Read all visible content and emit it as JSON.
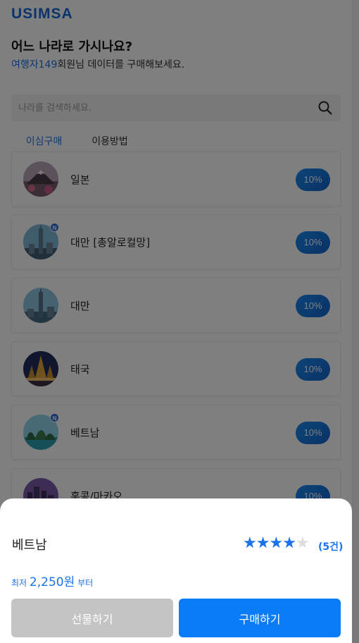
{
  "brand": {
    "logo": "USIMSA"
  },
  "header": {
    "title": "어느 나라로 가시나요?",
    "subtitle_highlight": "여행자149",
    "subtitle_rest": "회원님 데이터를 구매해보세요."
  },
  "search": {
    "placeholder": "나라를 검색하세요.",
    "value": "",
    "icon": "search-icon"
  },
  "tabs": [
    {
      "label": "이심구매",
      "active": true
    },
    {
      "label": "이용방법",
      "active": false
    }
  ],
  "countries": [
    {
      "name": "일본",
      "discount": "10%",
      "is_new": false,
      "badge": ""
    },
    {
      "name": "대만 [총알로컬망]",
      "discount": "10%",
      "is_new": true,
      "badge": "N"
    },
    {
      "name": "대만",
      "discount": "10%",
      "is_new": false,
      "badge": ""
    },
    {
      "name": "태국",
      "discount": "10%",
      "is_new": false,
      "badge": ""
    },
    {
      "name": "베트남",
      "discount": "10%",
      "is_new": true,
      "badge": "N"
    },
    {
      "name": "홍콩/마카오",
      "discount": "10%",
      "is_new": false,
      "badge": ""
    }
  ],
  "sheet": {
    "country": "베트남",
    "rating": 4,
    "rating_max": 5,
    "reviews": "(5건)",
    "price_prefix": "최저",
    "price_amount": "2,250원",
    "price_suffix": "부터",
    "gift_label": "선물하기",
    "buy_label": "구매하기"
  },
  "colors": {
    "accent": "#1a73e8",
    "buy_button": "#0a7cf7",
    "gift_button": "#c4c4c4",
    "overlay": "rgba(0,0,0,0.5)"
  }
}
